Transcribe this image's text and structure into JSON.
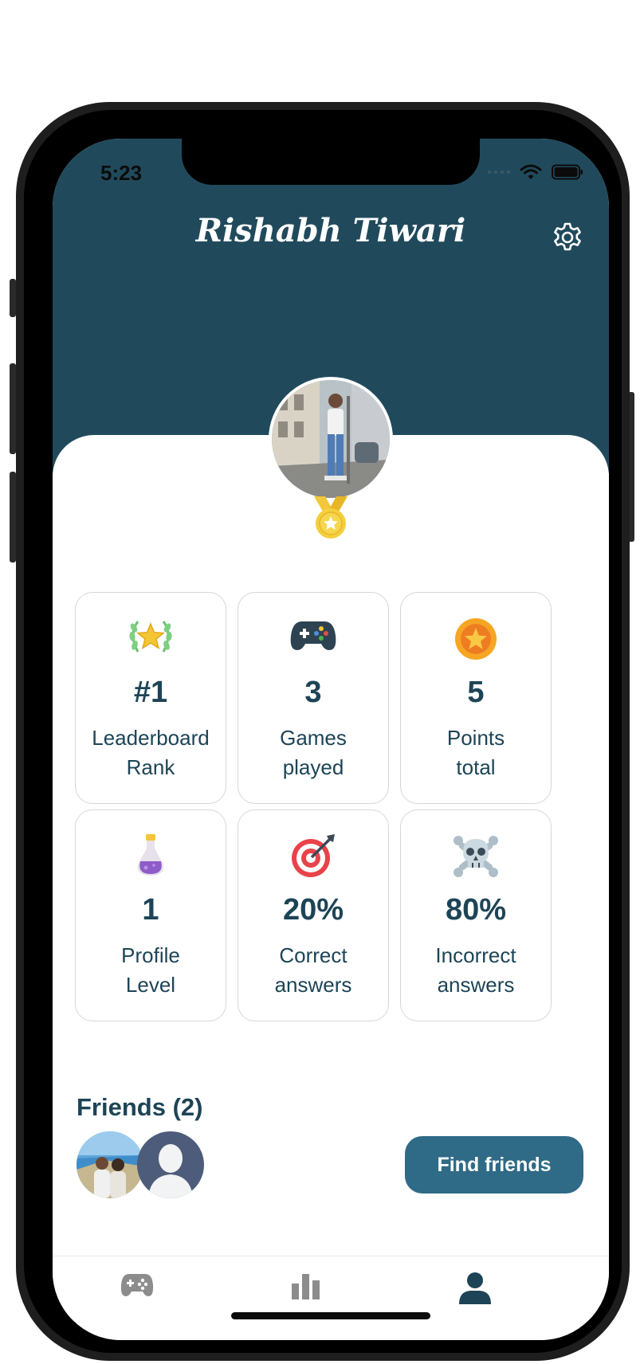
{
  "status_bar": {
    "time": "5:23"
  },
  "header": {
    "title": "Rishabh Tiwari"
  },
  "stats": [
    {
      "icon": "laurel-star-icon",
      "value": "#1",
      "label_line1": "Leaderboard",
      "label_line2": "Rank"
    },
    {
      "icon": "gamepad-icon",
      "value": "3",
      "label_line1": "Games",
      "label_line2": "played"
    },
    {
      "icon": "star-coin-icon",
      "value": "5",
      "label_line1": "Points",
      "label_line2": "total"
    },
    {
      "icon": "potion-icon",
      "value": "1",
      "label_line1": "Profile",
      "label_line2": "Level"
    },
    {
      "icon": "target-icon",
      "value": "20%",
      "label_line1": "Correct",
      "label_line2": "answers"
    },
    {
      "icon": "skull-crossbones-icon",
      "value": "80%",
      "label_line1": "Incorrect",
      "label_line2": "answers"
    }
  ],
  "friends": {
    "title": "Friends (2)",
    "button_label": "Find friends"
  },
  "tabs": [
    {
      "icon": "gamepad-icon",
      "active": false
    },
    {
      "icon": "bar-chart-icon",
      "active": false
    },
    {
      "icon": "person-icon",
      "active": true
    }
  ],
  "colors": {
    "header": "#204a5c",
    "text_primary": "#1d4456",
    "button": "#2f6a86",
    "tab_inactive": "#8c8c8c",
    "tab_active": "#1d4456"
  }
}
